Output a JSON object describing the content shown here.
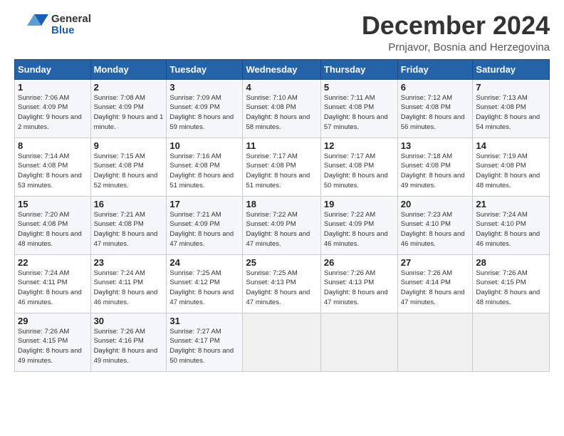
{
  "header": {
    "logo_general": "General",
    "logo_blue": "Blue",
    "title": "December 2024",
    "subtitle": "Prnjavor, Bosnia and Herzegovina"
  },
  "days_of_week": [
    "Sunday",
    "Monday",
    "Tuesday",
    "Wednesday",
    "Thursday",
    "Friday",
    "Saturday"
  ],
  "weeks": [
    [
      {
        "day": 1,
        "sunrise": "7:06 AM",
        "sunset": "4:09 PM",
        "daylight": "9 hours and 2 minutes."
      },
      {
        "day": 2,
        "sunrise": "7:08 AM",
        "sunset": "4:09 PM",
        "daylight": "9 hours and 1 minute."
      },
      {
        "day": 3,
        "sunrise": "7:09 AM",
        "sunset": "4:09 PM",
        "daylight": "8 hours and 59 minutes."
      },
      {
        "day": 4,
        "sunrise": "7:10 AM",
        "sunset": "4:08 PM",
        "daylight": "8 hours and 58 minutes."
      },
      {
        "day": 5,
        "sunrise": "7:11 AM",
        "sunset": "4:08 PM",
        "daylight": "8 hours and 57 minutes."
      },
      {
        "day": 6,
        "sunrise": "7:12 AM",
        "sunset": "4:08 PM",
        "daylight": "8 hours and 56 minutes."
      },
      {
        "day": 7,
        "sunrise": "7:13 AM",
        "sunset": "4:08 PM",
        "daylight": "8 hours and 54 minutes."
      }
    ],
    [
      {
        "day": 8,
        "sunrise": "7:14 AM",
        "sunset": "4:08 PM",
        "daylight": "8 hours and 53 minutes."
      },
      {
        "day": 9,
        "sunrise": "7:15 AM",
        "sunset": "4:08 PM",
        "daylight": "8 hours and 52 minutes."
      },
      {
        "day": 10,
        "sunrise": "7:16 AM",
        "sunset": "4:08 PM",
        "daylight": "8 hours and 51 minutes."
      },
      {
        "day": 11,
        "sunrise": "7:17 AM",
        "sunset": "4:08 PM",
        "daylight": "8 hours and 51 minutes."
      },
      {
        "day": 12,
        "sunrise": "7:17 AM",
        "sunset": "4:08 PM",
        "daylight": "8 hours and 50 minutes."
      },
      {
        "day": 13,
        "sunrise": "7:18 AM",
        "sunset": "4:08 PM",
        "daylight": "8 hours and 49 minutes."
      },
      {
        "day": 14,
        "sunrise": "7:19 AM",
        "sunset": "4:08 PM",
        "daylight": "8 hours and 48 minutes."
      }
    ],
    [
      {
        "day": 15,
        "sunrise": "7:20 AM",
        "sunset": "4:08 PM",
        "daylight": "8 hours and 48 minutes."
      },
      {
        "day": 16,
        "sunrise": "7:21 AM",
        "sunset": "4:08 PM",
        "daylight": "8 hours and 47 minutes."
      },
      {
        "day": 17,
        "sunrise": "7:21 AM",
        "sunset": "4:09 PM",
        "daylight": "8 hours and 47 minutes."
      },
      {
        "day": 18,
        "sunrise": "7:22 AM",
        "sunset": "4:09 PM",
        "daylight": "8 hours and 47 minutes."
      },
      {
        "day": 19,
        "sunrise": "7:22 AM",
        "sunset": "4:09 PM",
        "daylight": "8 hours and 46 minutes."
      },
      {
        "day": 20,
        "sunrise": "7:23 AM",
        "sunset": "4:10 PM",
        "daylight": "8 hours and 46 minutes."
      },
      {
        "day": 21,
        "sunrise": "7:24 AM",
        "sunset": "4:10 PM",
        "daylight": "8 hours and 46 minutes."
      }
    ],
    [
      {
        "day": 22,
        "sunrise": "7:24 AM",
        "sunset": "4:11 PM",
        "daylight": "8 hours and 46 minutes."
      },
      {
        "day": 23,
        "sunrise": "7:24 AM",
        "sunset": "4:11 PM",
        "daylight": "8 hours and 46 minutes."
      },
      {
        "day": 24,
        "sunrise": "7:25 AM",
        "sunset": "4:12 PM",
        "daylight": "8 hours and 47 minutes."
      },
      {
        "day": 25,
        "sunrise": "7:25 AM",
        "sunset": "4:13 PM",
        "daylight": "8 hours and 47 minutes."
      },
      {
        "day": 26,
        "sunrise": "7:26 AM",
        "sunset": "4:13 PM",
        "daylight": "8 hours and 47 minutes."
      },
      {
        "day": 27,
        "sunrise": "7:26 AM",
        "sunset": "4:14 PM",
        "daylight": "8 hours and 47 minutes."
      },
      {
        "day": 28,
        "sunrise": "7:26 AM",
        "sunset": "4:15 PM",
        "daylight": "8 hours and 48 minutes."
      }
    ],
    [
      {
        "day": 29,
        "sunrise": "7:26 AM",
        "sunset": "4:15 PM",
        "daylight": "8 hours and 49 minutes."
      },
      {
        "day": 30,
        "sunrise": "7:26 AM",
        "sunset": "4:16 PM",
        "daylight": "8 hours and 49 minutes."
      },
      {
        "day": 31,
        "sunrise": "7:27 AM",
        "sunset": "4:17 PM",
        "daylight": "8 hours and 50 minutes."
      },
      null,
      null,
      null,
      null
    ]
  ]
}
